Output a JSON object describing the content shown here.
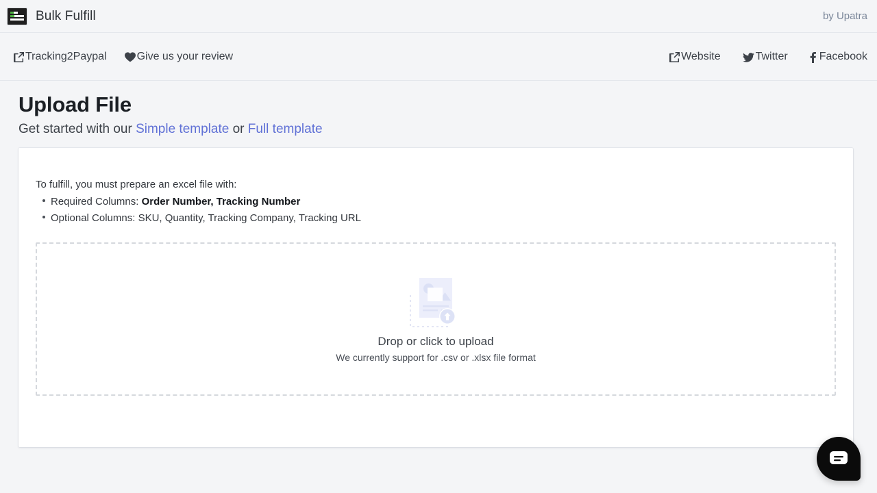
{
  "topbar": {
    "logo_icon": "bulk-fulfill-logo",
    "app_title": "Bulk Fulfill",
    "byline": "by Upatra"
  },
  "navbar": {
    "left_links": [
      {
        "label": "Tracking2Paypal",
        "icon": "external-link-icon"
      },
      {
        "label": "Give us your review",
        "icon": "heart-icon"
      }
    ],
    "right_links": [
      {
        "label": "Website",
        "icon": "external-link-icon"
      },
      {
        "label": "Twitter",
        "icon": "twitter-bird-icon"
      },
      {
        "label": "Facebook",
        "icon": "facebook-f-icon"
      }
    ]
  },
  "page": {
    "title": "Upload File",
    "subtitle_prefix": "Get started with our ",
    "simple_template_label": "Simple template",
    "subtitle_separator": " or ",
    "full_template_label": "Full template",
    "link_color": "#6071d6"
  },
  "card": {
    "intro": "To fulfill, you must prepare an excel file with:",
    "bullets": [
      {
        "label": "Required Columns: ",
        "value": "Order Number, Tracking Number",
        "bold_value": true
      },
      {
        "label": "Optional Columns: ",
        "value": "SKU, Quantity, Tracking Company, Tracking URL",
        "bold_value": false
      }
    ],
    "dropzone": {
      "icon": "upload-document-icon",
      "primary_text": "Drop or click to upload",
      "secondary_text": "We currently support for .csv or .xlsx file format"
    }
  },
  "chat": {
    "icon": "chat-bubble-icon",
    "background": "#0b0b0b"
  }
}
